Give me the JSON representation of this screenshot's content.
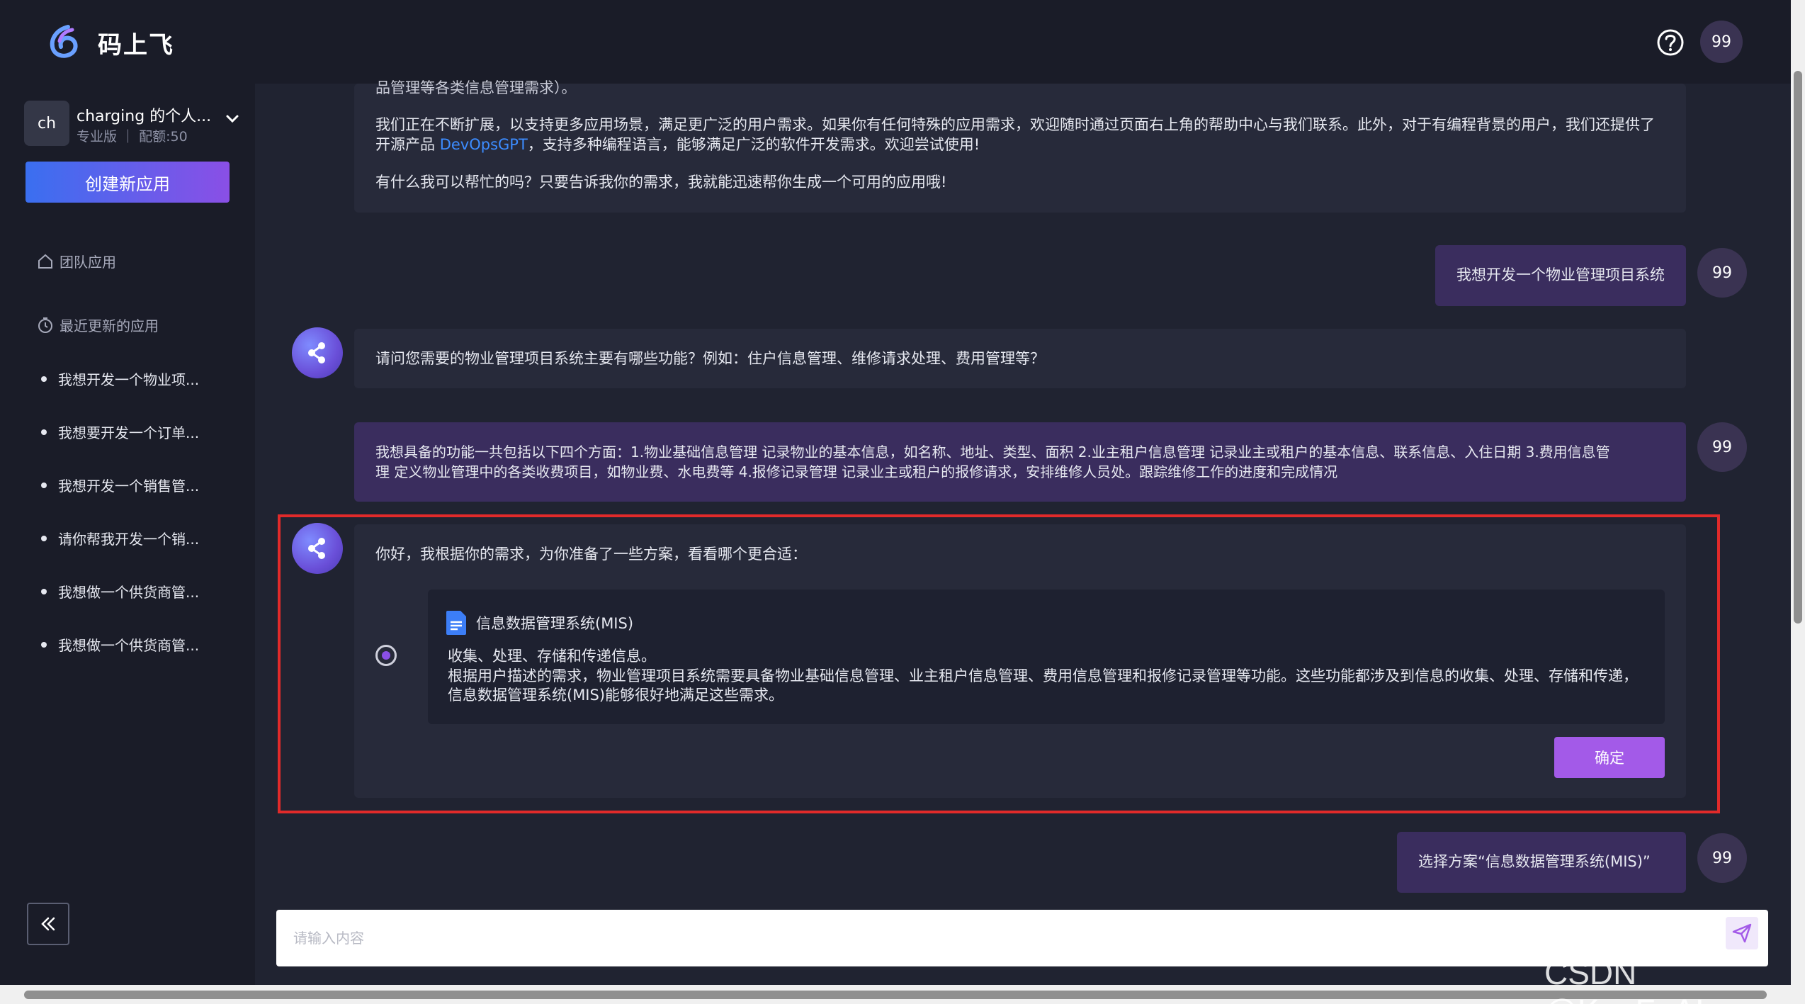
{
  "header": {
    "app_title": "码上飞",
    "user_avatar_text": "99"
  },
  "sidebar": {
    "user": {
      "avatar_text": "ch",
      "name": "charging 的个人...",
      "subtitle": "专业版 ｜ 配额:50"
    },
    "create_button": "创建新应用",
    "team_apps": "团队应用",
    "recent_apps": "最近更新的应用",
    "recent_items": [
      "我想开发一个物业项...",
      "我想要开发一个订单...",
      "我想开发一个销售管...",
      "请你帮我开发一个销...",
      "我想做一个供货商管...",
      "我想做一个供货商管..."
    ]
  },
  "chat": {
    "first_msg_cutoff": "品管理等各类信息管理需求）。",
    "first_msg_line1_a": "我们正在不断扩展，以支持更多应用场景，满足更广泛的用户需求。如果你有任何特殊的应用需求，欢迎随时通过页面右上角的帮助中心与我们联系。此外，对于有编程背景的用户，我们还提供了",
    "first_msg_line2_pre": "开源产品 ",
    "first_msg_link": "DevOpsGPT",
    "first_msg_line2_post": "，支持多种编程语言，能够满足广泛的软件开发需求。欢迎尝试使用!",
    "first_msg_line3": "有什么我可以帮忙的吗？只要告诉我你的需求，我就能迅速帮你生成一个可用的应用哦!",
    "user_msg_1": "我想开发一个物业管理项目系统",
    "bot_msg_1": "请问您需要的物业管理项目系统主要有哪些功能？例如：住户信息管理、维修请求处理、费用管理等？",
    "user_msg_2_line1": "我想具备的功能一共包括以下四个方面：1.物业基础信息管理 记录物业的基本信息，如名称、地址、类型、面积 2.业主租户信息管理 记录业主或租户的基本信息、联系信息、入住日期 3.费用信息管",
    "user_msg_2_line2": "理 定义物业管理中的各类收费项目，如物业费、水电费等 4.报修记录管理 记录业主或租户的报修请求，安排维修人员处。跟踪维修工作的进度和完成情况",
    "bot_msg_2": "你好，我根据你的需求，为你准备了一些方案，看看哪个更合适：",
    "option": {
      "title": "信息数据管理系统(MIS)",
      "line1": "收集、处理、存储和传递信息。",
      "line2": "根据用户描述的需求，物业管理项目系统需要具备物业基础信息管理、业主租户信息管理、费用信息管理和报修记录管理等功能。这些功能都涉及到信息的收集、处理、存储和传递，",
      "line3": "信息数据管理系统(MIS)能够很好地满足这些需求。"
    },
    "confirm_button": "确定",
    "user_msg_3": "选择方案“信息数据管理系统(MIS)”",
    "user_avatar_text": "99"
  },
  "input": {
    "placeholder": "请输入内容"
  },
  "watermark": "CSDN @KuaFuAI",
  "colors": {
    "accent": "#a35ae8",
    "highlight_border": "#e12a2a",
    "link": "#3c8cff"
  }
}
